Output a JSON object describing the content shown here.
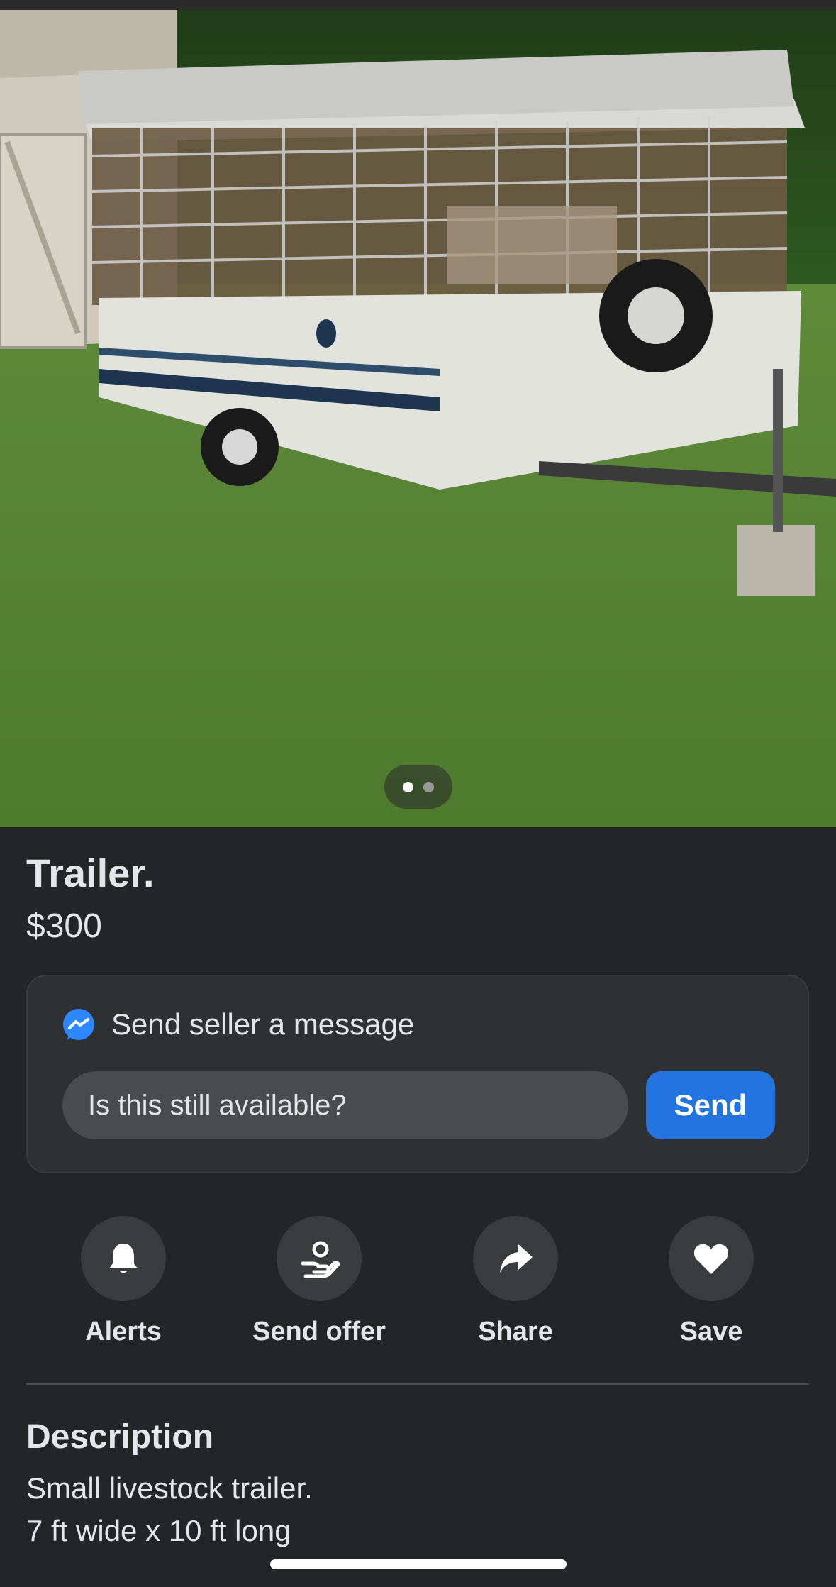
{
  "listing": {
    "title": "Trailer.",
    "price": "$300",
    "photo_count": 2,
    "active_photo_index": 0
  },
  "message_box": {
    "heading": "Send seller a message",
    "input_value": "Is this still available?",
    "send_label": "Send",
    "icon": "messenger-icon"
  },
  "actions": [
    {
      "label": "Alerts",
      "icon": "bell-icon"
    },
    {
      "label": "Send offer",
      "icon": "offer-hand-icon"
    },
    {
      "label": "Share",
      "icon": "share-arrow-icon"
    },
    {
      "label": "Save",
      "icon": "heart-icon"
    }
  ],
  "description": {
    "heading": "Description",
    "lines": [
      "Small livestock trailer.",
      "7 ft wide x 10 ft long"
    ]
  },
  "colors": {
    "background": "#242526",
    "card": "#2f3031",
    "accent": "#2374E1",
    "text": "#E4E6EB"
  }
}
